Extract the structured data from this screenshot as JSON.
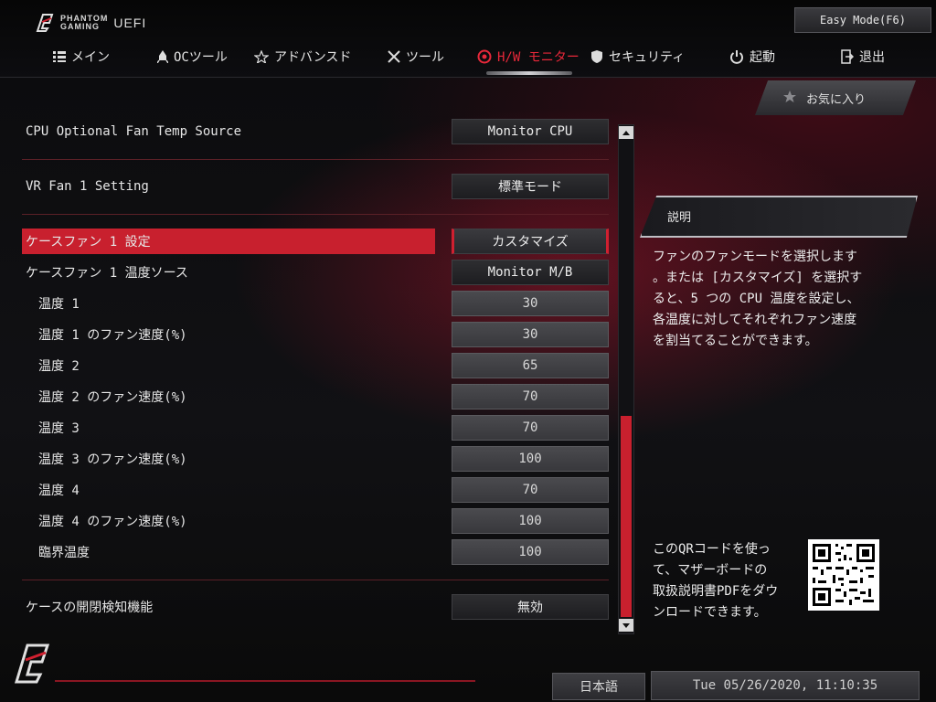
{
  "header": {
    "logo_line1": "PHANTOM",
    "logo_line2": "GAMING",
    "logo_uefi": "UEFI",
    "easy_mode_label": "Easy Mode(F6)"
  },
  "nav": [
    {
      "label": "メイン",
      "icon": "list-icon"
    },
    {
      "label": "OCツール",
      "icon": "rocket-icon"
    },
    {
      "label": "アドバンスド",
      "icon": "star-outline-icon"
    },
    {
      "label": "ツール",
      "icon": "tools-icon"
    },
    {
      "label": "H/W モニター",
      "icon": "monitor-gauge-icon",
      "active": true
    },
    {
      "label": "セキュリティ",
      "icon": "shield-icon"
    },
    {
      "label": "起動",
      "icon": "power-icon"
    },
    {
      "label": "退出",
      "icon": "exit-icon"
    }
  ],
  "settings": [
    {
      "label": "CPU Optional Fan Temp Source",
      "value": "Monitor CPU"
    },
    {
      "label": "VR Fan 1 Setting",
      "value": "標準モード"
    },
    {
      "label": "ケースファン 1 設定",
      "value": "カスタマイズ",
      "selected": true
    },
    {
      "label": "ケースファン 1 温度ソース",
      "value": "Monitor M/B"
    },
    {
      "label": "温度 1",
      "value": "30"
    },
    {
      "label": "温度 1 のファン速度(%)",
      "value": "30"
    },
    {
      "label": "温度 2",
      "value": "65"
    },
    {
      "label": "温度 2 のファン速度(%)",
      "value": "70"
    },
    {
      "label": "温度 3",
      "value": "70"
    },
    {
      "label": "温度 3 のファン速度(%)",
      "value": "100"
    },
    {
      "label": "温度 4",
      "value": "70"
    },
    {
      "label": "温度 4 のファン速度(%)",
      "value": "100"
    },
    {
      "label": "臨界温度",
      "value": "100"
    },
    {
      "label": "ケースの開閉検知機能",
      "value": "無効"
    }
  ],
  "favorites_label": "お気に入り",
  "description": {
    "title": "説明",
    "lines": [
      "ファンのファンモードを選択します",
      "。または [カスタマイズ] を選択す",
      "ると、5 つの CPU 温度を設定し、",
      "各温度に対してそれぞれファン速度",
      "を割当てることができます。"
    ]
  },
  "qr_text": [
    "このQRコードを使っ",
    "て、マザーボードの",
    "取扱説明書PDFをダウ",
    "ンロードできます。"
  ],
  "footer": {
    "language": "日本語",
    "datetime": "Tue 05/26/2020, 11:10:35"
  },
  "colors": {
    "accent": "#c8202e",
    "active_tab": "#e8283a"
  }
}
